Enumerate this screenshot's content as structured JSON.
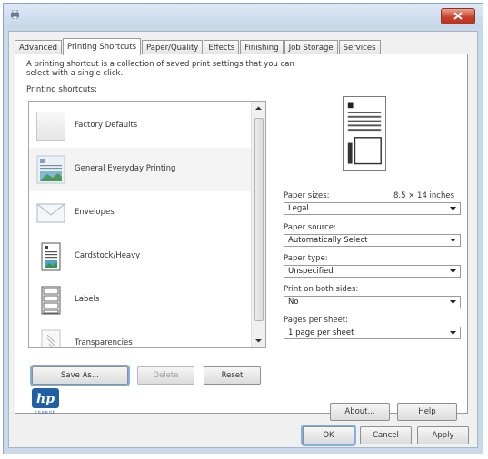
{
  "tabs": [
    "Advanced",
    "Printing Shortcuts",
    "Paper/Quality",
    "Effects",
    "Finishing",
    "Job Storage",
    "Services"
  ],
  "active_tab": "Printing Shortcuts",
  "description": "A printing shortcut is a collection of saved print settings that you can select with a single click.",
  "shortcuts_label": "Printing shortcuts:",
  "shortcuts": [
    {
      "label": "Factory Defaults",
      "icon": "factory-defaults-icon"
    },
    {
      "label": "General Everyday Printing",
      "icon": "general-everyday-printing-icon"
    },
    {
      "label": "Envelopes",
      "icon": "envelope-icon"
    },
    {
      "label": "Cardstock/Heavy",
      "icon": "cardstock-icon"
    },
    {
      "label": "Labels",
      "icon": "labels-icon"
    },
    {
      "label": "Transparencies",
      "icon": "transparencies-icon"
    }
  ],
  "selected_shortcut": "General Everyday Printing",
  "buttons": {
    "save_as": "Save As...",
    "delete": "Delete",
    "reset": "Reset",
    "about": "About...",
    "help": "Help",
    "ok": "OK",
    "cancel": "Cancel",
    "apply": "Apply"
  },
  "settings": {
    "paper_sizes_label": "Paper sizes:",
    "paper_size_dims": "8.5 × 14 inches",
    "paper_size_value": "Legal",
    "paper_source_label": "Paper source:",
    "paper_source_value": "Automatically Select",
    "paper_type_label": "Paper type:",
    "paper_type_value": "Unspecified",
    "print_both_sides_label": "Print on both sides:",
    "print_both_sides_value": "No",
    "pages_per_sheet_label": "Pages per sheet:",
    "pages_per_sheet_value": "1 page per sheet"
  },
  "brand": {
    "logo_text": "hp",
    "tagline": "invent"
  },
  "colors": {
    "hp_blue": "#1f5fa6",
    "close_red": "#c8422b",
    "focus_blue": "#7fb0e3",
    "window_frame": "#c9d9ea"
  }
}
